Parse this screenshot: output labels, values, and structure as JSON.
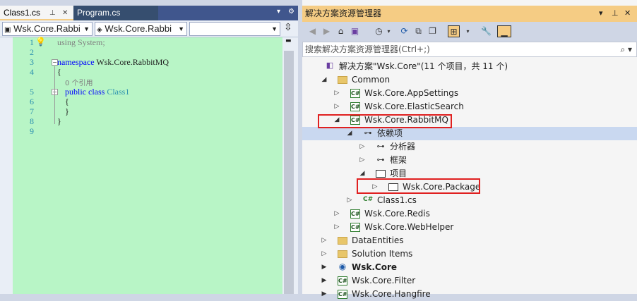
{
  "editor": {
    "tabs": [
      {
        "label": "Class1.cs",
        "pin": "⊥",
        "close": "✕"
      },
      {
        "label": "Program.cs"
      }
    ],
    "tab_menu_icon": "▾",
    "tab_gear_icon": "⚙",
    "nav": {
      "project_combo": "Wsk.Core.Rabbi",
      "class_combo": "Wsk.Core.Rabbi",
      "member_combo": ""
    },
    "lines": [
      {
        "n": "1",
        "text": "using System;"
      },
      {
        "n": "2",
        "text": ""
      },
      {
        "n": "3",
        "kw": "namespace",
        "rest": " Wsk.Core.RabbitMQ"
      },
      {
        "n": "4",
        "text": "{"
      },
      {
        "n": "",
        "ref": "0 个引用"
      },
      {
        "n": "5",
        "kw": "public class",
        "ty": " Class1"
      },
      {
        "n": "6",
        "text": "{"
      },
      {
        "n": "7",
        "text": "}"
      },
      {
        "n": "8",
        "text": "}"
      },
      {
        "n": "9",
        "text": ""
      }
    ]
  },
  "explorer": {
    "title": "解决方案资源管理器",
    "title_controls": [
      "▾",
      "⊥",
      "✕"
    ],
    "search_placeholder": "搜索解决方案资源管理器(Ctrl+;)",
    "search_icon": "⌕ ▾",
    "tree": [
      {
        "label": "解决方案\"Wsk.Core\"(11 个项目，共 11 个)",
        "icon": "sln",
        "depth": 0,
        "exp": ""
      },
      {
        "label": "Common",
        "icon": "folder",
        "depth": 1,
        "exp": "◢"
      },
      {
        "label": "Wsk.Core.AppSettings",
        "icon": "proj",
        "depth": 2,
        "exp": "▷"
      },
      {
        "label": "Wsk.Core.ElasticSearch",
        "icon": "proj",
        "depth": 2,
        "exp": "▷"
      },
      {
        "label": "Wsk.Core.RabbitMQ",
        "icon": "proj",
        "depth": 2,
        "exp": "◢"
      },
      {
        "label": "依赖项",
        "icon": "deps",
        "depth": 3,
        "exp": "◢",
        "selected": true
      },
      {
        "label": "分析器",
        "icon": "deps",
        "depth": 4,
        "exp": "▷"
      },
      {
        "label": "框架",
        "icon": "deps",
        "depth": 4,
        "exp": "▷"
      },
      {
        "label": "项目",
        "icon": "box",
        "depth": 4,
        "exp": "◢"
      },
      {
        "label": "Wsk.Core.Package",
        "icon": "box",
        "depth": 5,
        "exp": "▷"
      },
      {
        "label": "Class1.cs",
        "icon": "cs",
        "depth": 3,
        "exp": "▷"
      },
      {
        "label": "Wsk.Core.Redis",
        "icon": "proj",
        "depth": 2,
        "exp": "▷"
      },
      {
        "label": "Wsk.Core.WebHelper",
        "icon": "proj",
        "depth": 2,
        "exp": "▷"
      },
      {
        "label": "DataEntities",
        "icon": "folder",
        "depth": 1,
        "exp": "▷"
      },
      {
        "label": "Solution Items",
        "icon": "folder",
        "depth": 1,
        "exp": "▷"
      },
      {
        "label": "Wsk.Core",
        "icon": "web",
        "depth": 1,
        "exp": "▶",
        "bold": true
      },
      {
        "label": "Wsk.Core.Filter",
        "icon": "proj",
        "depth": 1,
        "exp": "▶"
      },
      {
        "label": "Wsk.Core.Hangfire",
        "icon": "proj",
        "depth": 1,
        "exp": "▶"
      }
    ]
  }
}
